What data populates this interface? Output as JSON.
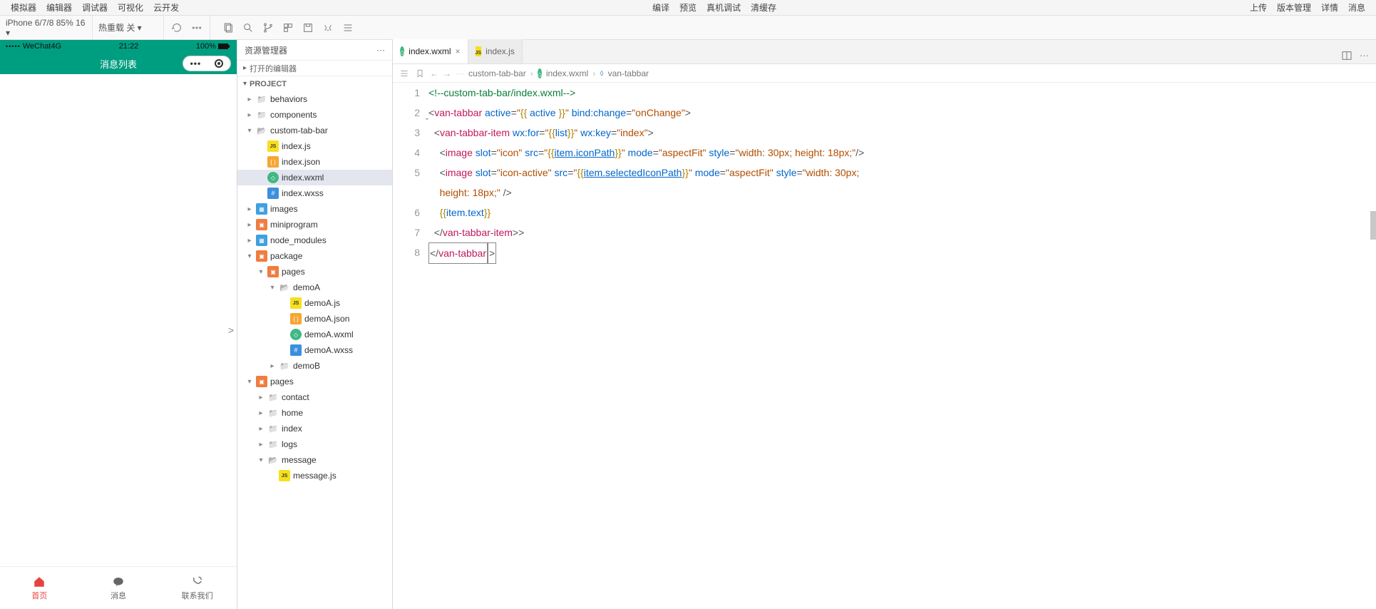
{
  "menu": {
    "left": [
      "模拟器",
      "编辑器",
      "调试器",
      "可视化",
      "云开发"
    ],
    "mid": [
      "编译",
      "预览",
      "真机调试",
      "清缓存"
    ],
    "right": [
      "上传",
      "版本管理",
      "详情",
      "消息"
    ]
  },
  "toolbar": {
    "device": "iPhone 6/7/8 85% 16 ▾",
    "hot": "热重载 关 ▾"
  },
  "simulator": {
    "carrier": "WeChat4G",
    "time": "21:22",
    "battery": "100%",
    "page_title": "消息列表",
    "tabs": [
      {
        "label": "首页",
        "active": true
      },
      {
        "label": "消息",
        "active": false
      },
      {
        "label": "联系我们",
        "active": false
      }
    ]
  },
  "explorer": {
    "title": "资源管理器",
    "sections": {
      "open_editors": "打开的编辑器",
      "project": "PROJECT"
    },
    "tree": [
      {
        "d": 0,
        "t": "folder",
        "exp": false,
        "label": "behaviors"
      },
      {
        "d": 0,
        "t": "folder",
        "exp": false,
        "label": "components"
      },
      {
        "d": 0,
        "t": "folder-o",
        "exp": true,
        "label": "custom-tab-bar"
      },
      {
        "d": 1,
        "t": "js",
        "label": "index.js"
      },
      {
        "d": 1,
        "t": "json",
        "label": "index.json"
      },
      {
        "d": 1,
        "t": "wxml",
        "label": "index.wxml",
        "sel": true
      },
      {
        "d": 1,
        "t": "wxss",
        "label": "index.wxss"
      },
      {
        "d": 0,
        "t": "blue",
        "exp": false,
        "label": "images"
      },
      {
        "d": 0,
        "t": "pkg",
        "exp": false,
        "label": "miniprogram"
      },
      {
        "d": 0,
        "t": "blue",
        "exp": false,
        "label": "node_modules"
      },
      {
        "d": 0,
        "t": "pkg",
        "exp": true,
        "label": "package"
      },
      {
        "d": 1,
        "t": "pkg",
        "exp": true,
        "label": "pages"
      },
      {
        "d": 2,
        "t": "folder-o",
        "exp": true,
        "label": "demoA"
      },
      {
        "d": 3,
        "t": "js",
        "label": "demoA.js"
      },
      {
        "d": 3,
        "t": "json",
        "label": "demoA.json"
      },
      {
        "d": 3,
        "t": "wxml",
        "label": "demoA.wxml"
      },
      {
        "d": 3,
        "t": "wxss",
        "label": "demoA.wxss"
      },
      {
        "d": 2,
        "t": "folder",
        "exp": false,
        "label": "demoB"
      },
      {
        "d": 0,
        "t": "pkg",
        "exp": true,
        "label": "pages"
      },
      {
        "d": 1,
        "t": "folder",
        "exp": false,
        "label": "contact"
      },
      {
        "d": 1,
        "t": "folder",
        "exp": false,
        "label": "home"
      },
      {
        "d": 1,
        "t": "folder",
        "exp": false,
        "label": "index"
      },
      {
        "d": 1,
        "t": "folder",
        "exp": false,
        "label": "logs"
      },
      {
        "d": 1,
        "t": "folder-o",
        "exp": true,
        "label": "message"
      },
      {
        "d": 2,
        "t": "js",
        "label": "message.js"
      }
    ]
  },
  "editor": {
    "tabs": [
      {
        "icon": "wxml",
        "label": "index.wxml",
        "active": true,
        "dirty": false
      },
      {
        "icon": "js",
        "label": "index.js",
        "active": false,
        "dirty": false
      }
    ],
    "breadcrumbs": [
      "custom-tab-bar",
      "index.wxml",
      "van-tabbar"
    ],
    "lines": [
      {
        "n": 1,
        "html": "<span class='tok-comment'>&lt;!--custom-tab-bar/index.wxml--&gt;</span>"
      },
      {
        "n": 2,
        "fold": true,
        "html": "<span class='tok-punc'>&lt;</span><span class='tok-tag'>van-tabbar</span> <span class='tok-attr'>active</span><span class='tok-punc'>=</span><span class='tok-str'>\"</span><span class='tok-brace'>{{</span> <span class='tok-attr'>active</span> <span class='tok-brace'>}}</span><span class='tok-str'>\"</span> <span class='tok-attr'>bind:change</span><span class='tok-punc'>=</span><span class='tok-str'>\"onChange\"</span><span class='tok-punc'>&gt;</span>"
      },
      {
        "n": 3,
        "html": "  <span class='tok-punc'>&lt;</span><span class='tok-tag'>van-tabbar-item</span> <span class='tok-attr'>wx:for</span><span class='tok-punc'>=</span><span class='tok-str'>\"</span><span class='tok-brace'>{{</span><span class='tok-attr'>list</span><span class='tok-brace'>}}</span><span class='tok-str'>\"</span> <span class='tok-attr'>wx:key</span><span class='tok-punc'>=</span><span class='tok-str'>\"index\"</span><span class='tok-punc'>&gt;</span>"
      },
      {
        "n": 4,
        "html": "    <span class='tok-punc'>&lt;</span><span class='tok-tag'>image</span> <span class='tok-attr'>slot</span><span class='tok-punc'>=</span><span class='tok-str'>\"icon\"</span> <span class='tok-attr'>src</span><span class='tok-punc'>=</span><span class='tok-str'>\"</span><span class='tok-brace'>{{</span><span class='tok-var2'>item.iconPath</span><span class='tok-brace'>}}</span><span class='tok-str'>\"</span> <span class='tok-attr'>mode</span><span class='tok-punc'>=</span><span class='tok-str'>\"aspectFit\"</span> <span class='tok-attr'>style</span><span class='tok-punc'>=</span><span class='tok-str'>\"width: 30px; height: 18px;\"</span><span class='tok-punc'>/&gt;</span>"
      },
      {
        "n": 5,
        "html": "    <span class='tok-punc'>&lt;</span><span class='tok-tag'>image</span> <span class='tok-attr'>slot</span><span class='tok-punc'>=</span><span class='tok-str'>\"icon-active\"</span> <span class='tok-attr'>src</span><span class='tok-punc'>=</span><span class='tok-str'>\"</span><span class='tok-brace'>{{</span><span class='tok-var2'>item.selectedIconPath</span><span class='tok-brace'>}}</span><span class='tok-str'>\"</span> <span class='tok-attr'>mode</span><span class='tok-punc'>=</span><span class='tok-str'>\"aspectFit\"</span> <span class='tok-attr'>style</span><span class='tok-punc'>=</span><span class='tok-str'>\"width: 30px; </span><br>    <span class='tok-str'>height: 18px;\"</span> <span class='tok-punc'>/&gt;</span>"
      },
      {
        "n": 6,
        "html": "    <span class='tok-brace'>{{</span><span class='tok-attr'>item.text</span><span class='tok-brace'>}}</span>"
      },
      {
        "n": 7,
        "html": "  <span class='tok-punc'>&lt;/</span><span class='tok-tag'>van-tabbar-item</span><span class='tok-punc'>&gt;</span><span class='tok-punc'>&gt;</span>"
      },
      {
        "n": 8,
        "html": "<span class='cursor-box'><span class='tok-punc'>&lt;/</span><span class='tok-tag'>van-tabbar</span></span><span class='cursor-box'><span class='tok-punc'>&gt;</span></span>"
      }
    ]
  }
}
